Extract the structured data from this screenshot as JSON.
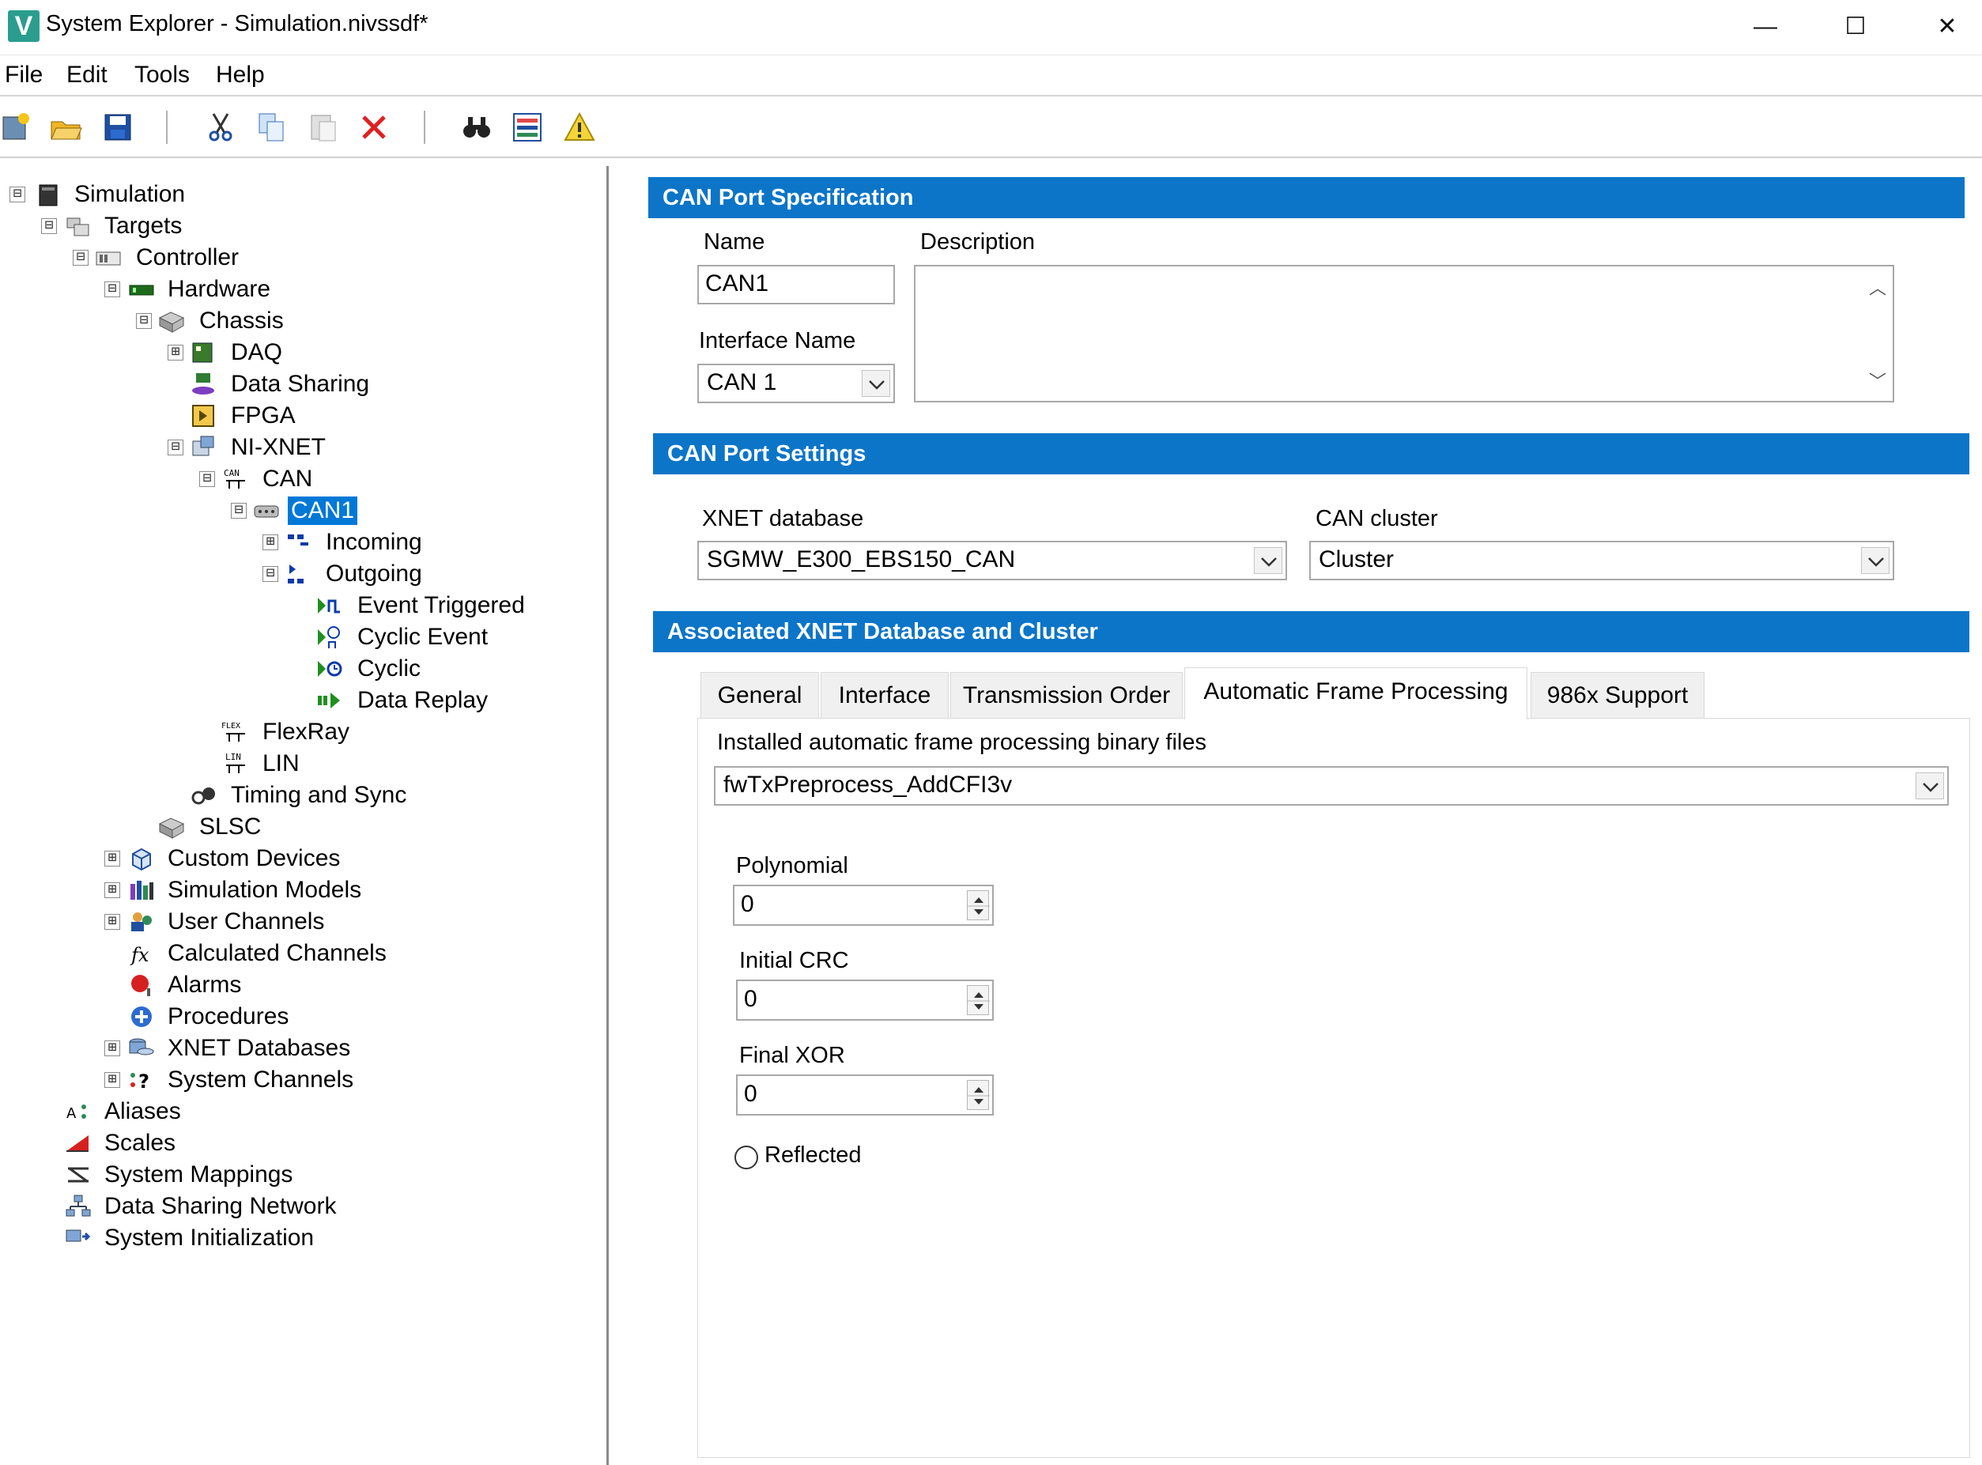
{
  "window": {
    "title": "System Explorer - Simulation.nivssdf*",
    "logo_letter": "V",
    "minimize": "—",
    "maximize": "☐",
    "close": "✕"
  },
  "menu": [
    "File",
    "Edit",
    "Tools",
    "Help"
  ],
  "toolbar_icons": [
    "new-icon",
    "open-icon",
    "save-icon",
    "cut-icon",
    "copy-icon",
    "paste-icon",
    "delete-icon",
    "find-icon",
    "view-options-icon",
    "warning-icon"
  ],
  "tree": [
    {
      "label": "Simulation",
      "toggle": "⊟"
    },
    {
      "label": "Targets",
      "toggle": "⊟"
    },
    {
      "label": "Controller",
      "toggle": "⊟"
    },
    {
      "label": "Hardware",
      "toggle": "⊟"
    },
    {
      "label": "Chassis",
      "toggle": "⊟"
    },
    {
      "label": "DAQ",
      "toggle": "⊞"
    },
    {
      "label": "Data Sharing",
      "toggle": ""
    },
    {
      "label": "FPGA",
      "toggle": ""
    },
    {
      "label": "NI-XNET",
      "toggle": "⊟"
    },
    {
      "label": "CAN",
      "toggle": "⊟"
    },
    {
      "label": "CAN1",
      "toggle": "⊟"
    },
    {
      "label": "Incoming",
      "toggle": "⊞"
    },
    {
      "label": "Outgoing",
      "toggle": "⊟"
    },
    {
      "label": "Event Triggered",
      "toggle": ""
    },
    {
      "label": "Cyclic Event",
      "toggle": ""
    },
    {
      "label": "Cyclic",
      "toggle": ""
    },
    {
      "label": "Data Replay",
      "toggle": ""
    },
    {
      "label": "FlexRay",
      "toggle": ""
    },
    {
      "label": "LIN",
      "toggle": ""
    },
    {
      "label": "Timing and Sync",
      "toggle": ""
    },
    {
      "label": "SLSC",
      "toggle": ""
    },
    {
      "label": "Custom Devices",
      "toggle": "⊞"
    },
    {
      "label": "Simulation Models",
      "toggle": "⊞"
    },
    {
      "label": "User Channels",
      "toggle": "⊞"
    },
    {
      "label": "Calculated Channels",
      "toggle": ""
    },
    {
      "label": "Alarms",
      "toggle": ""
    },
    {
      "label": "Procedures",
      "toggle": ""
    },
    {
      "label": "XNET Databases",
      "toggle": "⊞"
    },
    {
      "label": "System Channels",
      "toggle": "⊞"
    },
    {
      "label": "Aliases",
      "toggle": ""
    },
    {
      "label": "Scales",
      "toggle": ""
    },
    {
      "label": "System Mappings",
      "toggle": ""
    },
    {
      "label": "Data Sharing Network",
      "toggle": ""
    },
    {
      "label": "System Initialization",
      "toggle": ""
    }
  ],
  "port_spec": {
    "header": "CAN Port Specification",
    "name_label": "Name",
    "name_value": "CAN1",
    "description_label": "Description",
    "description_value": "",
    "interface_label": "Interface Name",
    "interface_value": "CAN 1"
  },
  "port_settings": {
    "header": "CAN Port Settings",
    "db_label": "XNET database",
    "db_value": "SGMW_E300_EBS150_CAN",
    "cluster_label": "CAN cluster",
    "cluster_value": "Cluster"
  },
  "assoc": {
    "header": "Associated XNET Database and Cluster",
    "tabs": [
      "General",
      "Interface",
      "Transmission Order",
      "Automatic Frame Processing",
      "986x Support"
    ],
    "active_tab": "Automatic Frame Processing",
    "installed_label": "Installed automatic frame processing binary files",
    "installed_value": "fwTxPreprocess_AddCFI3v",
    "polynomial_label": "Polynomial",
    "polynomial_value": "0",
    "initial_crc_label": "Initial CRC",
    "initial_crc_value": "0",
    "final_xor_label": "Final XOR",
    "final_xor_value": "0",
    "reflected_label": "Reflected",
    "reflected_checked": false
  },
  "colors": {
    "section_header": "#0c75c8",
    "selection": "#0078d7",
    "logo": "#2a9d8f"
  }
}
